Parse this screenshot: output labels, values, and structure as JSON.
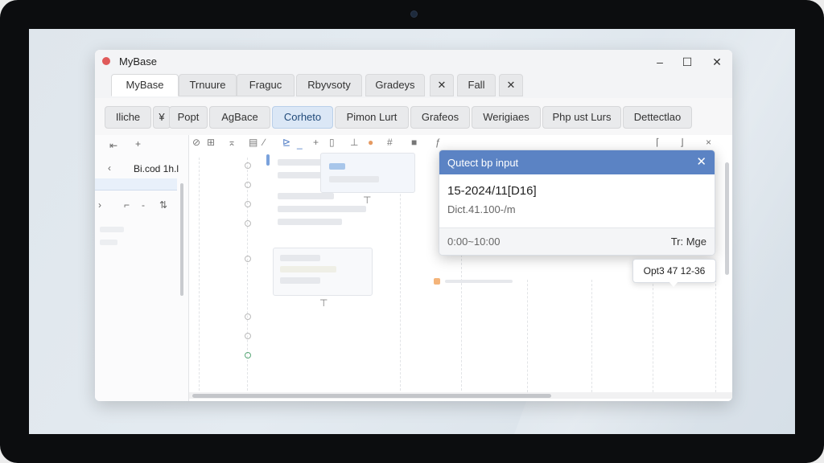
{
  "app": {
    "title": "MyBase"
  },
  "document_tabs": [
    {
      "label": "MyBase",
      "active": true
    },
    {
      "label": "Trnuure"
    },
    {
      "label": "Fraguc"
    },
    {
      "label": "Rbyvsoty"
    },
    {
      "label": "Gradeys"
    },
    {
      "label": "Fall"
    }
  ],
  "toolbar": [
    {
      "label": "Iliche"
    },
    {
      "label": "¥"
    },
    {
      "label": "Popt"
    },
    {
      "label": "AgBace"
    },
    {
      "label": "Corheto",
      "selected": true
    },
    {
      "label": "Pimon Lurt"
    },
    {
      "label": "Grafeos"
    },
    {
      "label": "Werigiaes"
    },
    {
      "label": "Php ust Lurs"
    },
    {
      "label": "Dettectlao"
    }
  ],
  "left_panel": {
    "title": "Bi.cod 1h.l"
  },
  "dialog": {
    "title": "Qutect bp input",
    "value": "15-2024/11[D16]",
    "subtext": "Dict.41.100-/m",
    "range": "0:00~10:00",
    "action": "Tr: Mge"
  },
  "tooltip": {
    "text": "Opt3 47 12-36"
  },
  "colors": {
    "dialog_header": "#5b83c4",
    "selected_tab": "#dbe7f6",
    "app_logo": "#e05a5a",
    "orange_marker": "#f4b47a"
  }
}
